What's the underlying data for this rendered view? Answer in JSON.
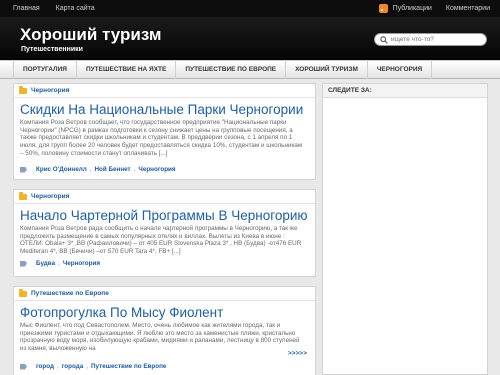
{
  "topnav": {
    "items": [
      {
        "label": "Главная"
      },
      {
        "label": "Карта сайта"
      }
    ]
  },
  "topright": {
    "items": [
      {
        "label": "Публикации"
      },
      {
        "label": "Комментарии"
      }
    ],
    "icon": "rss-icon"
  },
  "header": {
    "title": "Хороший туризм",
    "description": "Путешественники"
  },
  "search": {
    "placeholder": "ищете что-то?",
    "icon": "search-icon"
  },
  "menu": {
    "items": [
      {
        "label": "Португалия"
      },
      {
        "label": "Путешествие на яхте"
      },
      {
        "label": "Путешествие по Европе"
      },
      {
        "label": "Хороший туризм"
      },
      {
        "label": "Черногория"
      }
    ]
  },
  "posts": [
    {
      "category": "Черногория",
      "title": "Скидки На Национальные Парки Черногории",
      "excerpt": "Компания Роза Ветров сообщает, что государственное предприятие \"Национальные парки Черногории\" (NPCG) в рамках подготовки к сезону снижает цены на групповые посещения, а также предоставляет скидки школьникам и студентам. В преддверии сезона, с 1 апреля по 1 июля, для групп более 20 человек будет предоставляться скидка 10%, студентам и школьникам – 50%, половину стоимости станут оплачивать [...]",
      "tags": [
        "Крис О'Доннелл",
        "Ной Беннет",
        "Черногория"
      ]
    },
    {
      "category": "Черногория",
      "title": "Начало Чартерной Программы В Черногорию",
      "excerpt": "Компания Роза Ветров рада сообщить о начале чартерной программы в Черногорию, а так же предложить размещение в самых популярных отелях и виллах. Вылеты из Киева в июне : ОТЕЛИ: Obala+ 3* ,BB (Рафаиловичи) – от 405 EUR Slovenska Plaza 3* , НВ (Будва) -от476 EUR Mediteran 4*, BB (Бечичи) –от 570 EUR Tara 4*, FB+ [...]",
      "tags": [
        "Будва",
        "Черногория"
      ]
    },
    {
      "category": "Путешествие по Европе",
      "title": "Фотопрогулка По Мысу Фиолент",
      "excerpt": "Мыс Фиолент, что под Севастополем. Место, очень любимое как жителями города, так и приезжими туристами и отдыхающими. Я люблю это место за каменистые пляжи, кристально прозрачную воду моря, изобилующую крабами, мидиями и рапанами, лестницу в 800 ступеней из камня, выложенную на",
      "more": ">>>>>",
      "tags": [
        "город",
        "города",
        "Путешествие по Европе"
      ]
    }
  ],
  "sidebar": {
    "title": "СЛЕДИТЕ ЗА:"
  },
  "colors": {
    "link": "#1f5fa8",
    "header_bg": "#0d0d0d",
    "accent_rss": "#f08a24"
  }
}
